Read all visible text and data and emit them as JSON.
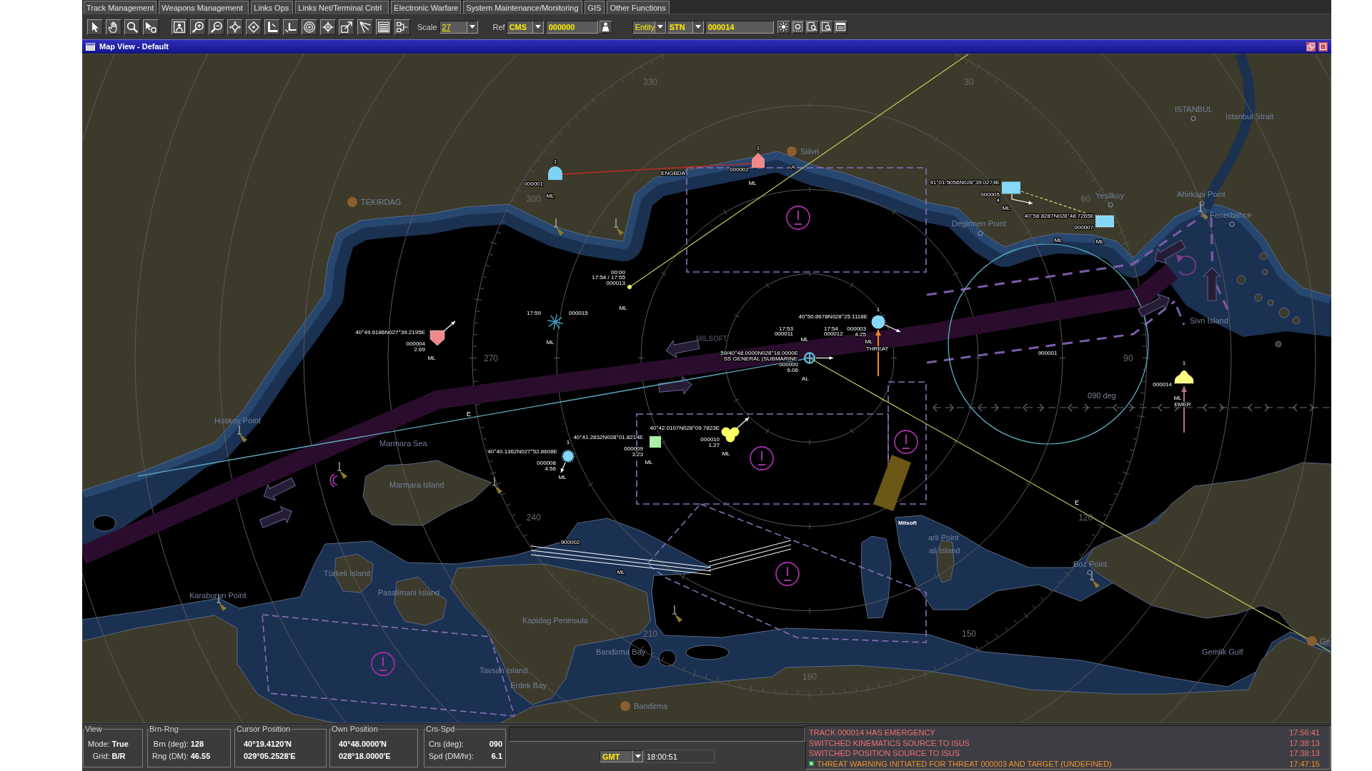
{
  "menu": [
    "Track Management",
    "Weapons Management",
    "Links Ops",
    "Links Net/Terminal Cntrl",
    "Electronic Warfare",
    "System Maintenance/Monitoring",
    "GIS",
    "Other Functions"
  ],
  "toolbar": {
    "scale": {
      "label": "Scale",
      "value": "27"
    },
    "reference": {
      "label": "Ref",
      "system": "CMS",
      "track": "000000"
    },
    "entity": {
      "type": "Entity",
      "system": "STN",
      "track": "000014"
    }
  },
  "window": {
    "title": "Map View - Default"
  },
  "map": {
    "places": [
      {
        "name": "Silivri",
        "kind": "city"
      },
      {
        "name": "TEKIRDAG",
        "kind": "city"
      },
      {
        "name": "ISTANBUL",
        "kind": "point"
      },
      {
        "name": "Istanbul Strait",
        "kind": "region"
      },
      {
        "name": "Ahirkapi Point",
        "kind": "point"
      },
      {
        "name": "Fenerbahce",
        "kind": "point"
      },
      {
        "name": "Degirmen Point",
        "kind": "point"
      },
      {
        "name": "Yesilkoy",
        "kind": "point"
      },
      {
        "name": "Sivri Island",
        "kind": "region"
      },
      {
        "name": "Hoskoy Point",
        "kind": "region"
      },
      {
        "name": "Marmara Sea",
        "kind": "region"
      },
      {
        "name": "Marmara Island",
        "kind": "region"
      },
      {
        "name": "Türkeli Island",
        "kind": "region"
      },
      {
        "name": "Pasalimani Island",
        "kind": "region"
      },
      {
        "name": "Karaburun Point",
        "kind": "region"
      },
      {
        "name": "Kapidag Peninsula",
        "kind": "region"
      },
      {
        "name": "Bandirma Bay",
        "kind": "region"
      },
      {
        "name": "Tavsan Island",
        "kind": "region"
      },
      {
        "name": "Erdek Bay",
        "kind": "region"
      },
      {
        "name": "Bandirma",
        "kind": "city"
      },
      {
        "name": "Boz Point",
        "kind": "point"
      },
      {
        "name": "Gemlik Gulf",
        "kind": "region"
      },
      {
        "name": "Ge",
        "kind": "city"
      },
      {
        "name": "arli Point",
        "kind": "region"
      },
      {
        "name": "ali Island",
        "kind": "region"
      }
    ],
    "bearings": [
      "330",
      "30",
      "300",
      "60",
      "270",
      "90",
      "240",
      "120",
      "210",
      "150",
      "180"
    ],
    "sector_label": "090 deg",
    "tracks": [
      {
        "id": "000001",
        "kind": "dome",
        "color": "#7dd3f5",
        "count": "1",
        "source": "ML"
      },
      {
        "id": "000002",
        "kind": "house",
        "color": "#f08a8a",
        "count": "1",
        "source": "ML",
        "link": "ENGBDA",
        "flag": "A"
      },
      {
        "id": "000013",
        "kind": "dot",
        "color": "#f0f05a",
        "times": [
          "00:00",
          "17:54 / 17:55"
        ],
        "source": "ML"
      },
      {
        "id": "000015",
        "kind": "asterisk",
        "color": "#3a9ec0",
        "times": [
          "17:59"
        ],
        "source": "ML"
      },
      {
        "id": "000004",
        "kind": "shield",
        "color": "#f08a8a",
        "position": "40°49.6186N027°39.2195E",
        "speed": "2.69",
        "source": "ML"
      },
      {
        "id": "000011",
        "kind": "label",
        "times": [
          "17:53"
        ],
        "source": "ML"
      },
      {
        "id": "000012",
        "kind": "label",
        "times": [
          "17:54"
        ]
      },
      {
        "id": "000003",
        "kind": "circle",
        "color": "#86d8f8",
        "count": "1",
        "position": "40°50.8678N028°25.1118E",
        "speed": "4.25",
        "source": "ML",
        "status": {
          "text": "THREAT",
          "kind": "threat"
        }
      },
      {
        "id": "000000",
        "kind": "ownship",
        "color": "#5ab4d2",
        "position": "59/40°48.0000N028°18.0000E",
        "name": "SS GENERAL (SUBMARINE",
        "speed": "6.06",
        "source": "AL"
      },
      {
        "id": "000005",
        "kind": "rect",
        "color": "#86d8f8",
        "position": "41°01.5056N028°39.0274E",
        "speed": "4",
        "source": "ML"
      },
      {
        "id": "000007",
        "kind": "rect-dashed",
        "color": "#86d8f8",
        "position": "40°58.8287N028°48.7265E",
        "source": "ML"
      },
      {
        "id": "000014",
        "kind": "bumpy-dome",
        "color": "#ffff80",
        "count": "1",
        "source": "ML",
        "status": {
          "text": "EMER",
          "kind": "emergency"
        }
      },
      {
        "id": "000008",
        "kind": "burst",
        "color": "#86d8f8",
        "count": "1",
        "position": "40°40.1362N027°52.8608E",
        "speed": "4.56",
        "source": "ML"
      },
      {
        "id": "000009",
        "kind": "square",
        "color": "#a8f0a8",
        "position": "40°41.2832N028°01.8214E",
        "speed": "3.23",
        "source": "ML"
      },
      {
        "id": "000010",
        "kind": "cloud",
        "color": "#ffff66",
        "position": "40°42.0107N028°09.7823E",
        "speed": "1.27",
        "source": "ML"
      }
    ],
    "track_histories": [
      {
        "id": "900001"
      },
      {
        "id": "900002",
        "source": "ML"
      }
    ],
    "unassigned_labels": [
      "ML"
    ],
    "line_labels": [
      "E",
      "E"
    ],
    "vendor_marks": [
      {
        "text": "MILSOFT",
        "kind": "logo"
      },
      {
        "text": "Milsoft",
        "kind": "tag"
      }
    ]
  },
  "status": {
    "panels": [
      {
        "title": "View",
        "kind": "pairs",
        "rows": [
          {
            "label": "Mode:",
            "value": "True"
          },
          {
            "label": "Grid:",
            "value": "B/R"
          }
        ]
      },
      {
        "title": "Brn-Rng",
        "kind": "pairs",
        "rows": [
          {
            "label": "Brn (deg):",
            "value": "128"
          },
          {
            "label": "Rng (DM):",
            "value": "46.55"
          }
        ]
      },
      {
        "title": "Cursor Position",
        "kind": "lines",
        "lines": [
          "40°19.4120'N",
          "029°05.2528'E"
        ]
      },
      {
        "title": "Own Position",
        "kind": "lines",
        "lines": [
          "40°48.0000'N",
          "028°18.0000'E"
        ]
      },
      {
        "title": "Crs-Spd",
        "kind": "table",
        "rows": [
          {
            "label": "Crs (deg):",
            "value": "090"
          },
          {
            "label": "Spd (DM/hr):",
            "value": "6.1"
          }
        ]
      }
    ],
    "clock": {
      "zone": "GMT",
      "time": "18:00:51"
    },
    "messages": [
      {
        "text": "TRACK 000014 HAS EMERGENCY",
        "time": "17:56:41",
        "kind": "alert"
      },
      {
        "text": "SWITCHED KINEMATICS SOURCE TO ISUS",
        "time": "17:38:13",
        "kind": "alert"
      },
      {
        "text": "SWITCHED POSITION SOURCE TO ISUS",
        "time": "17:38:13",
        "kind": "alert"
      },
      {
        "text": "THREAT WARNING INITIATED FOR THREAT 000003 AND TARGET (UNDEFINED)",
        "time": "17:47:15",
        "kind": "warning"
      }
    ]
  }
}
